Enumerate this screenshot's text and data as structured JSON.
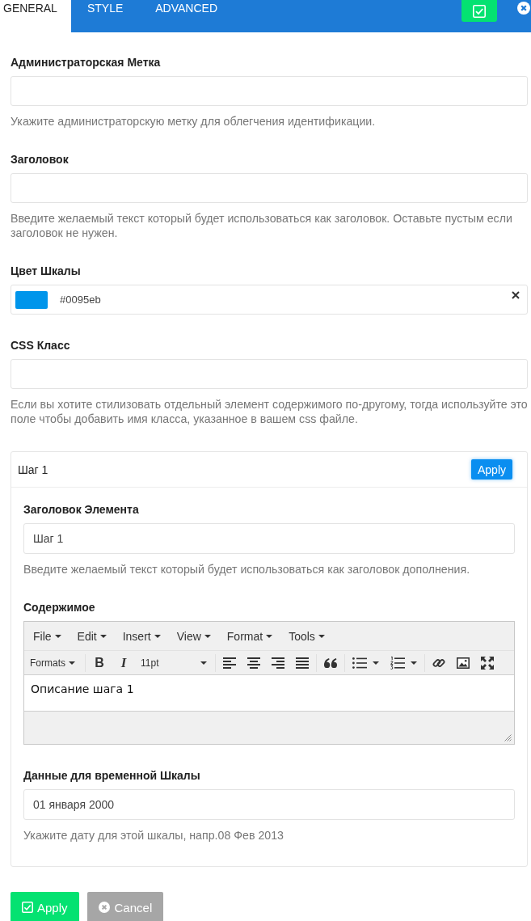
{
  "tabs": [
    {
      "label": "GENERAL",
      "selected": true
    },
    {
      "label": "STYLE",
      "selected": false
    },
    {
      "label": "ADVANCED",
      "selected": false
    }
  ],
  "fields": [
    {
      "kind": "text",
      "label": "Администраторская Метка",
      "help": "Укажите администраторскую метку для облегчения идентификации."
    },
    {
      "kind": "text",
      "label": "Заголовок",
      "help": "Введите желаемый текст который будет использоваться как заголовок. Оставьте пустым если заголовок не нужен."
    },
    {
      "kind": "color",
      "label": "Цвет Шкалы",
      "value": "#0095eb",
      "color": "#0095eb"
    },
    {
      "kind": "text",
      "label": "CSS Класс",
      "help": "Если вы хотите стилизовать отдельный элемент содержимого по-другому, тогда используйте это поле чтобы добавить имя класса, указанное в вашем css файле."
    }
  ],
  "item_panel": {
    "title": "Шаг 1",
    "apply_button": "Apply",
    "fields": [
      {
        "kind": "text",
        "label": "Заголовок Элемента",
        "value": "Шаг 1",
        "help": "Введите желаемый текст который будет использоваться как заголовок дополнения."
      },
      {
        "kind": "editor",
        "label": "Содержимое",
        "menus": [
          "File",
          "Edit",
          "Insert",
          "View",
          "Format",
          "Tools"
        ],
        "toolbar": [
          [
            {
              "kind": "dropdown",
              "label": "Formats"
            }
          ],
          [
            {
              "kind": "bold",
              "label": "B"
            },
            {
              "kind": "italic",
              "label": "I"
            },
            {
              "kind": "size",
              "label": "11pt"
            }
          ],
          [
            {
              "kind": "align-left"
            },
            {
              "kind": "align-center"
            },
            {
              "kind": "align-right"
            },
            {
              "kind": "align-justify"
            }
          ],
          [
            {
              "kind": "quote"
            }
          ],
          [
            {
              "kind": "bullet-list"
            },
            {
              "kind": "numbered-list"
            }
          ],
          [
            {
              "kind": "link"
            },
            {
              "kind": "image"
            },
            {
              "kind": "fullscreen"
            }
          ]
        ],
        "content": "Описание шага 1"
      },
      {
        "kind": "text",
        "label": "Данные для временной Шкалы",
        "value": "01 января 2000",
        "help": "Укажите дату для этой шкалы, напр.08 Фев 2013"
      }
    ]
  },
  "buttons": [
    {
      "kind": "apply",
      "label": "Apply"
    },
    {
      "kind": "cancel",
      "label": "Cancel"
    }
  ]
}
